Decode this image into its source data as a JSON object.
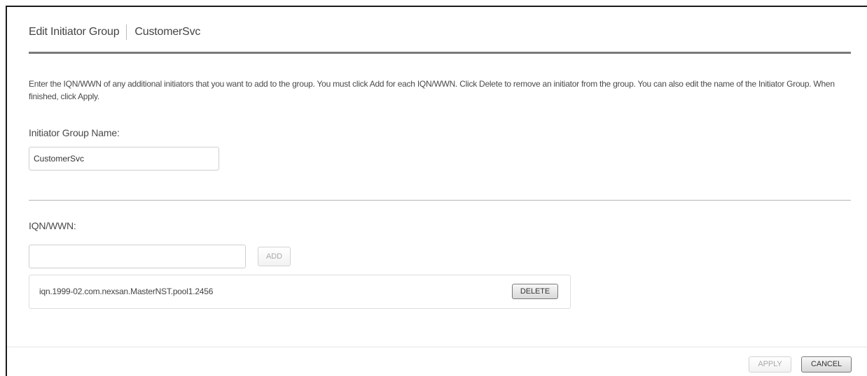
{
  "dialog": {
    "title": "Edit Initiator Group",
    "subtitle": "CustomerSvc"
  },
  "instructions": "Enter the IQN/WWN of any additional initiators that you want to add to the group. You must click Add for each IQN/WWN. Click Delete to remove an initiator from the group. You can also edit the name of the Initiator Group. When finished, click Apply.",
  "group_name": {
    "label": "Initiator Group Name:",
    "value": "CustomerSvc"
  },
  "iqn": {
    "label": "IQN/WWN:",
    "value": "",
    "add_label": "ADD"
  },
  "initiators": [
    {
      "name": "iqn.1999-02.com.nexsan.MasterNST.pool1.2456",
      "delete_label": "DELETE"
    }
  ],
  "footer": {
    "apply_label": "APPLY",
    "cancel_label": "CANCEL"
  }
}
